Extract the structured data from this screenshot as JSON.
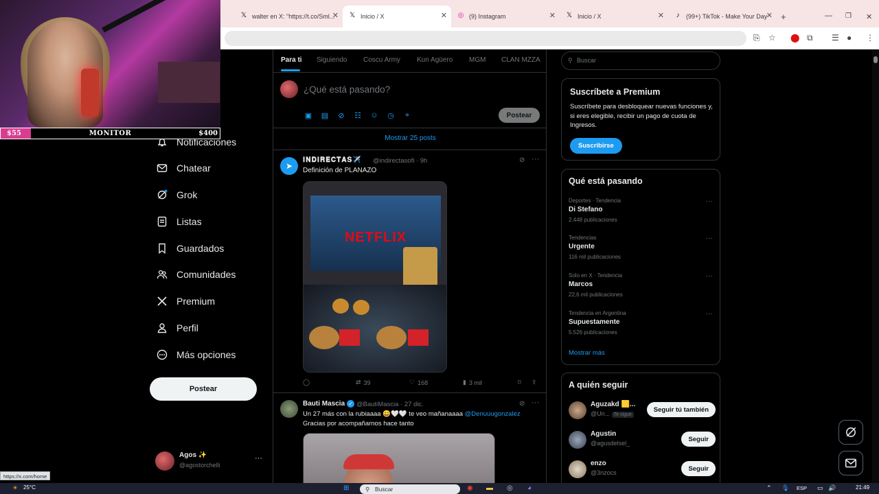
{
  "browser": {
    "tabs": [
      {
        "title": "walter en X: \"https://t.co/Sml...",
        "icon": "x"
      },
      {
        "title": "Inicio / X",
        "icon": "x",
        "active": true
      },
      {
        "title": "(9) Instagram",
        "icon": "instagram"
      },
      {
        "title": "Inicio / X",
        "icon": "x"
      },
      {
        "title": "(99+) TikTok - Make Your Day",
        "icon": "tiktok"
      }
    ],
    "status_link": "https://x.com/home"
  },
  "overlay": {
    "monitor_left": "$55",
    "monitor_title": "MONITOR",
    "monitor_right": "$400",
    "progress_fraction": 0.1375,
    "progress_color": "#d93d91"
  },
  "nav": {
    "items": [
      {
        "label": "Notificaciones",
        "icon": "bell-icon"
      },
      {
        "label": "Chatear",
        "icon": "mail-icon"
      },
      {
        "label": "Grok",
        "icon": "grok-icon"
      },
      {
        "label": "Listas",
        "icon": "list-icon"
      },
      {
        "label": "Guardados",
        "icon": "bookmark-icon"
      },
      {
        "label": "Comunidades",
        "icon": "people-icon"
      },
      {
        "label": "Premium",
        "icon": "x-logo-icon"
      },
      {
        "label": "Perfil",
        "icon": "person-icon"
      },
      {
        "label": "Más opciones",
        "icon": "more-circle-icon"
      }
    ],
    "post_button": "Postear",
    "profile_name": "Agos ✨",
    "profile_handle": "@agostorchelli"
  },
  "feed": {
    "tabs": [
      "Para ti",
      "Siguiendo",
      "Coscu Army",
      "Kun Agüero",
      "MGM",
      "CLAN MZZA"
    ],
    "composer_placeholder": "¿Qué está pasando?",
    "composer_post": "Postear",
    "show_posts": "Mostrar 25 posts",
    "post1": {
      "name": "𝐈𝐍𝐃𝐈𝐑𝐄𝐂𝐓𝐀𝐒✈️",
      "handle": "@indirectasofi · 9h",
      "text": "Definición de PLANAZO",
      "image_text": "NETFLIX",
      "retweets": "39",
      "likes": "168",
      "views": "3 mil"
    },
    "post2": {
      "name": "Bauti Mascia",
      "handle": "@BautiMascia · 27 dic.",
      "text_prefix": "Un 27 más con la rubiaaaa 😄🤍🤍 te veo mañanaaaa ",
      "mention": "@Denuuugonzalez",
      "text_line2": "Gracias por acompañarnos hace tanto"
    }
  },
  "sidebar": {
    "search_placeholder": "Buscar",
    "premium": {
      "title": "Suscríbete a Premium",
      "body": "Suscríbete para desbloquear nuevas funciones y, si eres elegible, recibir un pago de cuota de Ingresos.",
      "button": "Suscribirse"
    },
    "trends_title": "Qué está pasando",
    "trends": [
      {
        "category": "Deportes · Tendencia",
        "name": "Di Stefano",
        "count": "2.448 publicaciones"
      },
      {
        "category": "Tendencias",
        "name": "Urgente",
        "count": "116 mil publicaciones"
      },
      {
        "category": "Solo en X · Tendencia",
        "name": "Marcos",
        "count": "22,6 mil publicaciones"
      },
      {
        "category": "Tendencia en Argentina",
        "name": "Supuestamente",
        "count": "5.526 publicaciones"
      }
    ],
    "show_more": "Mostrar más",
    "who_to_follow_title": "A quién seguir",
    "follows": [
      {
        "name": "Aguzakd 🟨...",
        "handle": "@Un...",
        "badge": "Te sigue",
        "button": "Seguir tú también"
      },
      {
        "name": "Agustin",
        "handle": "@agusdelsel_",
        "button": "Seguir"
      },
      {
        "name": "enzo",
        "handle": "@3nzocs",
        "button": "Seguir"
      }
    ]
  },
  "taskbar": {
    "weather": "25°C",
    "search": "Buscar",
    "lang": "ESP",
    "time": "21:49"
  },
  "colors": {
    "accent": "#1d9bf0",
    "background": "#000000",
    "border": "#2f3336",
    "tabbar": "#f7e4e4"
  }
}
